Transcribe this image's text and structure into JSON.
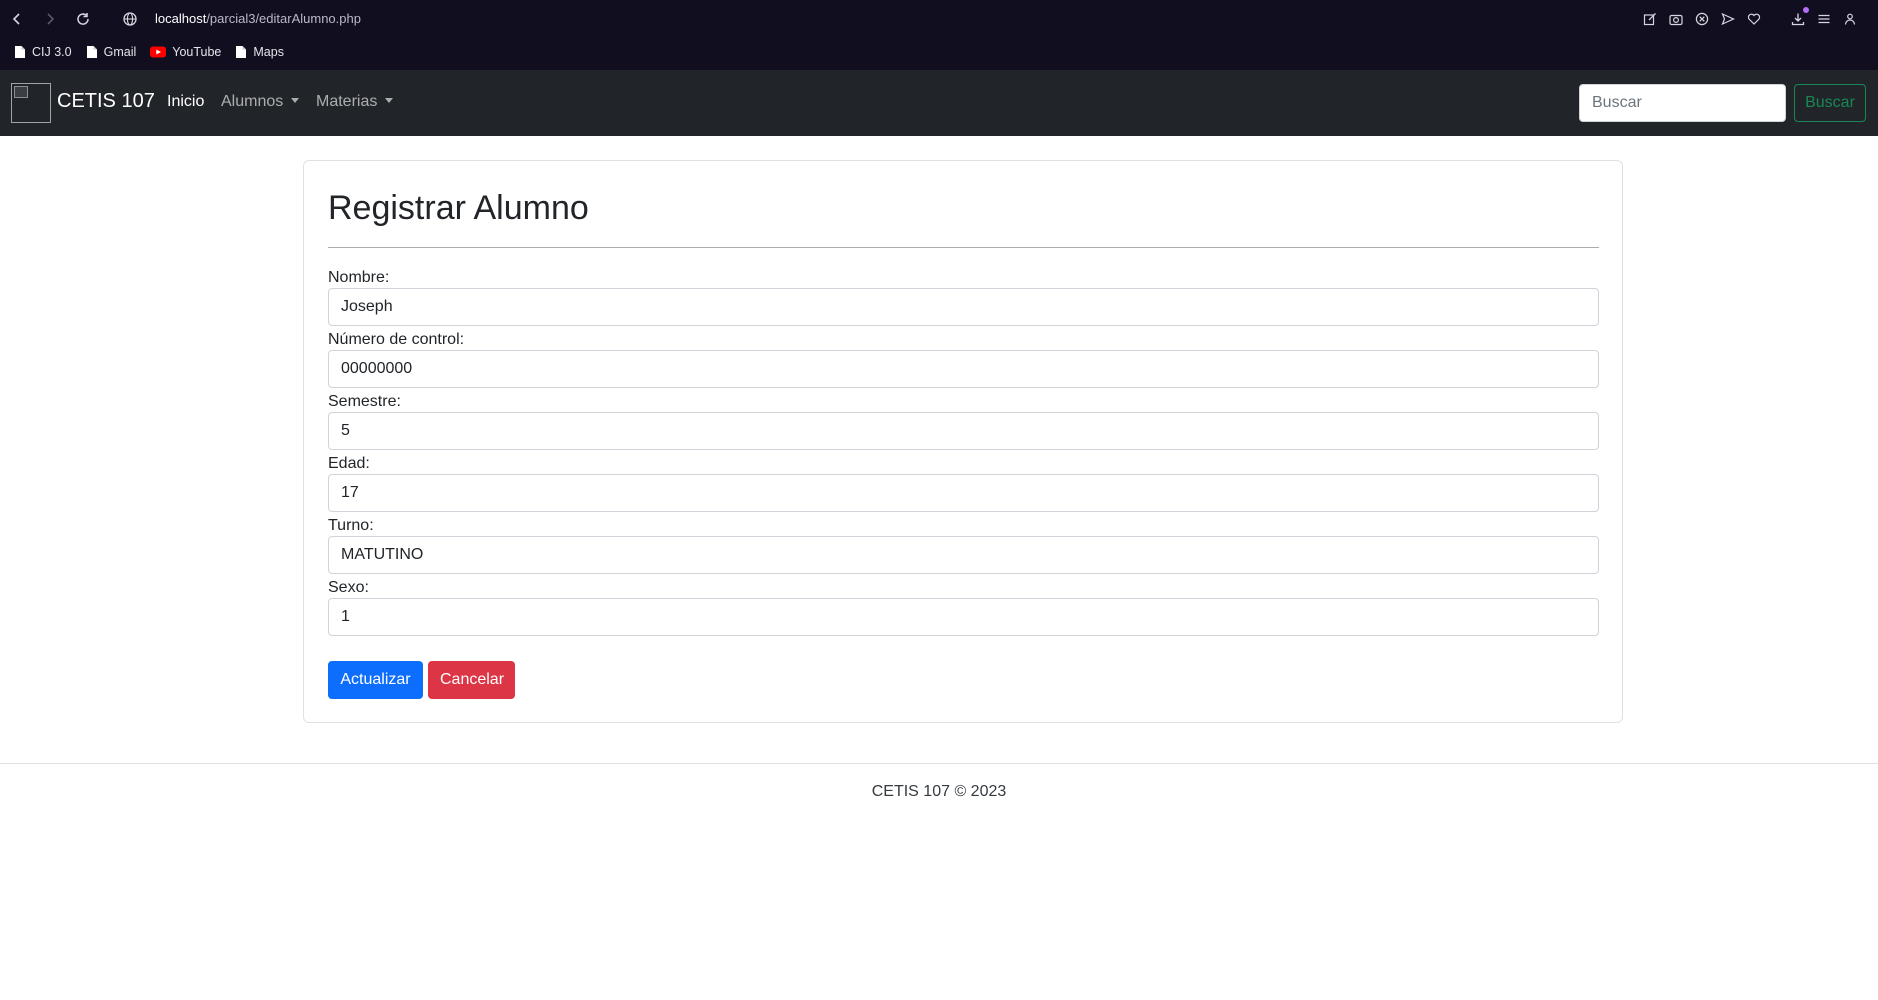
{
  "browser": {
    "url_host": "localhost",
    "url_path": "/parcial3/editarAlumno.php",
    "bookmarks": [
      {
        "label": "CIJ 3.0",
        "icon": "file-icon"
      },
      {
        "label": "Gmail",
        "icon": "file-icon"
      },
      {
        "label": "YouTube",
        "icon": "youtube-icon"
      },
      {
        "label": "Maps",
        "icon": "file-icon"
      }
    ]
  },
  "navbar": {
    "brand": "CETIS 107",
    "links": {
      "inicio": "Inicio",
      "alumnos": "Alumnos",
      "materias": "Materias"
    },
    "search_placeholder": "Buscar",
    "search_button": "Buscar"
  },
  "form": {
    "title": "Registrar Alumno",
    "fields": [
      {
        "label": "Nombre:",
        "value": "Joseph"
      },
      {
        "label": "Número de control:",
        "value": "00000000"
      },
      {
        "label": "Semestre:",
        "value": "5"
      },
      {
        "label": "Edad:",
        "value": "17"
      },
      {
        "label": "Turno:",
        "value": "MATUTINO"
      },
      {
        "label": "Sexo:",
        "value": "1"
      }
    ],
    "submit_label": "Actualizar",
    "cancel_label": "Cancelar"
  },
  "footer": {
    "text": "CETIS 107 © 2023"
  },
  "colors": {
    "primary": "#0d6efd",
    "danger": "#dc3545",
    "success": "#198754",
    "navbar_bg": "#212529",
    "chrome_bg": "#110f1f"
  }
}
